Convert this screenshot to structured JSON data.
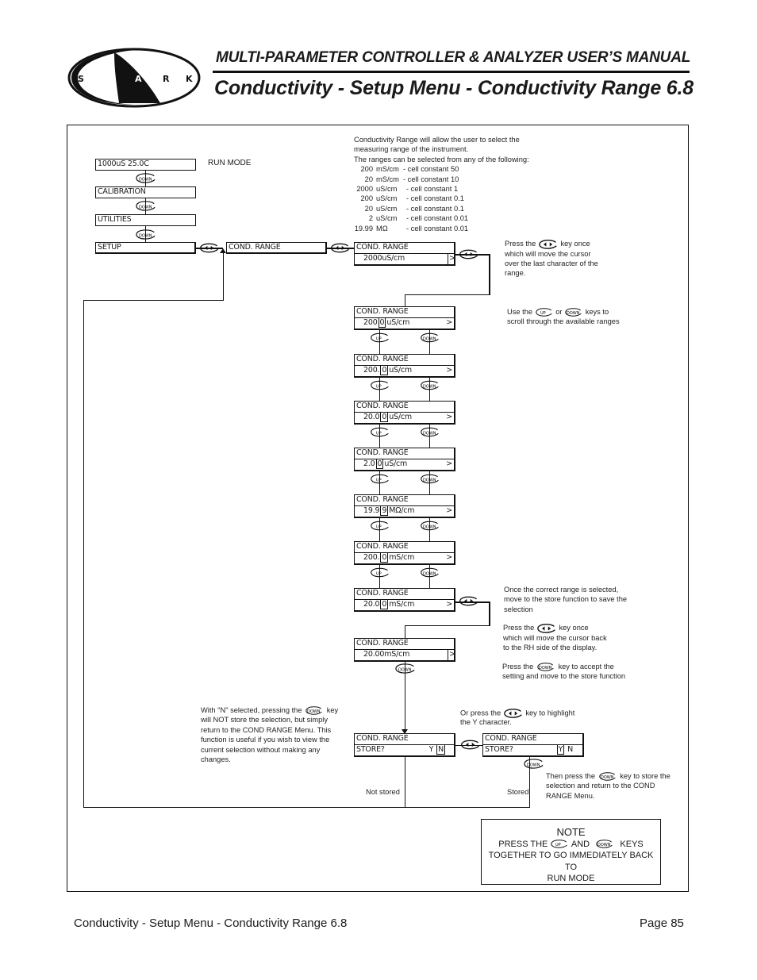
{
  "header": {
    "logo_text": "SHARK",
    "manual_title": "MULTI-PARAMETER CONTROLLER & ANALYZER USER’S MANUAL",
    "page_title": "Conductivity - Setup Menu - Conductivity Range 6.8"
  },
  "intro": {
    "lines": [
      "Conductivity Range will allow the user to select the",
      "measuring range of the instrument.",
      "The ranges can be selected from any of the following:"
    ],
    "ranges": [
      {
        "value": "200",
        "unit": "mS/cm",
        "desc": "- cell constant 50"
      },
      {
        "value": "20",
        "unit": "mS/cm",
        "desc": "- cell constant 10"
      },
      {
        "value": "2000",
        "unit": "uS/cm",
        "desc": "- cell constant 1"
      },
      {
        "value": "200",
        "unit": "uS/cm",
        "desc": "- cell constant 0.1"
      },
      {
        "value": "20",
        "unit": "uS/cm",
        "desc": "- cell constant 0.1"
      },
      {
        "value": "2",
        "unit": "uS/cm",
        "desc": "- cell constant 0.01"
      },
      {
        "value": "19.99",
        "unit": "MΩ",
        "desc": "- cell constant 0.01"
      }
    ]
  },
  "menu": {
    "run_display": "1000uS   25.0C",
    "run_label": "RUN MODE",
    "calibration": "CALIBRATION",
    "utilities": "UTILITIES",
    "setup": "SETUP",
    "cond_range": "COND. RANGE"
  },
  "keys": {
    "down": "DOWN",
    "up": "UP"
  },
  "displays": {
    "title": "COND. RANGE",
    "initial": {
      "value": "2000uS/cm",
      "arrow": ">"
    },
    "scroll": [
      {
        "pre": "200",
        "cursor": "0",
        "post": "uS/cm",
        "arrow": ">"
      },
      {
        "pre": "200.",
        "cursor": "0",
        "post": "uS/cm",
        "arrow": ">"
      },
      {
        "pre": "20.0",
        "cursor": "0",
        "post": "uS/cm",
        "arrow": ">"
      },
      {
        "pre": "2.0",
        "cursor": "0",
        "post": "uS/cm",
        "arrow": ">"
      },
      {
        "pre": "19.9",
        "cursor": "9",
        "post": "MΩ/cm",
        "arrow": ">"
      },
      {
        "pre": "200.",
        "cursor": "0",
        "post": "mS/cm",
        "arrow": ">"
      },
      {
        "pre": "20.0",
        "cursor": "0",
        "post": "mS/cm",
        "arrow": ">"
      }
    ],
    "final": {
      "value": "20.00mS/cm",
      "arrow": ">"
    },
    "store_n": {
      "label": "STORE?",
      "y": "Y",
      "n": "N"
    },
    "store_y": {
      "label": "STORE?",
      "y": "Y",
      "n": "N"
    }
  },
  "notes": {
    "press_lr_once": [
      "Press the",
      "key once",
      "which will move the cursor",
      "over the last character of the",
      "range."
    ],
    "use_up_down": [
      "Use the",
      "or",
      "keys to",
      "scroll through the available ranges"
    ],
    "once_correct": [
      "Once the correct range is selected,",
      "move to the store function to save the",
      "selection"
    ],
    "press_lr_back": [
      "Press the",
      "key once",
      "which will move the cursor back",
      "to the RH side of the display."
    ],
    "press_down_accept": [
      "Press the",
      "key to accept the",
      "setting and move to the store function"
    ],
    "or_press_lr": [
      "Or press the",
      "key to highlight",
      "the Y character."
    ],
    "with_n": [
      "With \"N\" selected, pressing the",
      "key",
      "will NOT store the selection, but simply",
      "return to the COND RANGE Menu. This",
      "function is useful if you wish to view the",
      "current selection without making any",
      "changes."
    ],
    "then_press_down": [
      "Then press the",
      "key to store the",
      "selection and return to the COND",
      "RANGE Menu."
    ],
    "not_stored": "Not stored",
    "stored": "Stored"
  },
  "note_box": {
    "title": "NOTE",
    "line1_a": "PRESS THE",
    "line1_b": "AND",
    "line1_c": "KEYS",
    "line2": "TOGETHER TO GO IMMEDIATELY BACK TO",
    "line3": "RUN MODE"
  },
  "footer": {
    "left": "Conductivity - Setup Menu - Conductivity Range 6.8",
    "page": "Page 85"
  }
}
